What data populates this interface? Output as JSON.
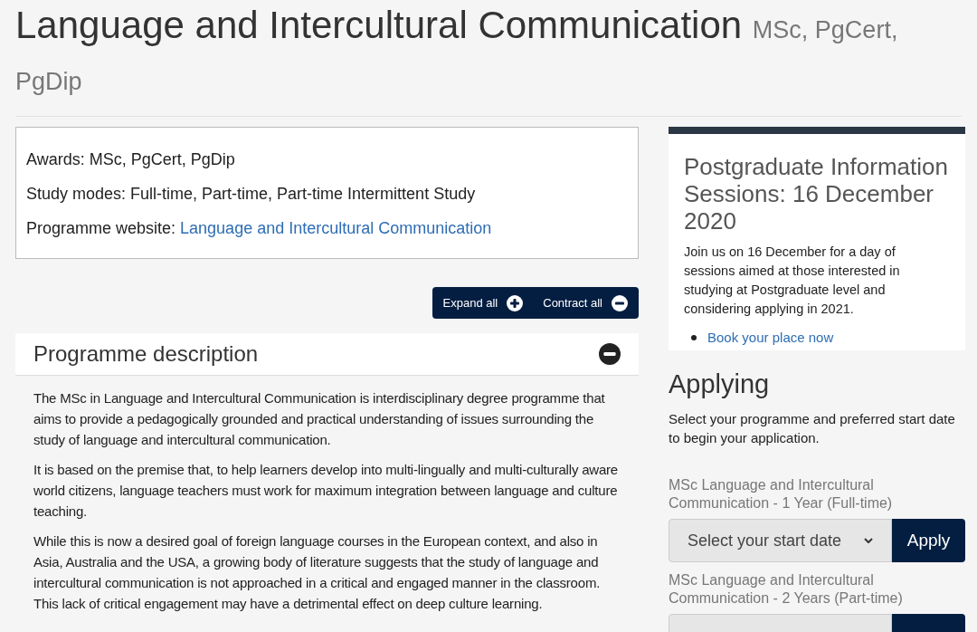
{
  "page_title": "Language and Intercultural Communication",
  "title_awards": "MSc, PgCert, PgDip",
  "summary": [
    {
      "label": "Awards:",
      "value": "MSc, PgCert, PgDip",
      "kind": "text"
    },
    {
      "label": "Study modes:",
      "value": "Full-time, Part-time, Part-time Intermittent Study",
      "kind": "text"
    },
    {
      "label": "Programme website:",
      "value": "Language and Intercultural Communication",
      "kind": "link"
    }
  ],
  "accordion_controls": [
    {
      "label": "Expand all",
      "kind": "expand"
    },
    {
      "label": "Contract all",
      "kind": "contract"
    }
  ],
  "sections": [
    {
      "title": "Programme description",
      "expanded": true,
      "paragraphs": [
        "The MSc in Language and Intercultural Communication is interdisciplinary degree programme that aims to provide a pedagogically grounded and practical understanding of issues surrounding the study of language and intercultural communication.",
        "It is based on the premise that, to help learners develop into multi-lingually and multi-culturally aware world citizens, language teachers must work for maximum integration between language and culture teaching.",
        "While this is now a desired goal of foreign language courses in the European context, and also in Asia, Australia and the USA, a growing body of literature suggests that the study of language and intercultural communication is not approached in a critical and engaged manner in the classroom. This lack of critical engagement may have a detrimental effect on deep culture learning."
      ]
    }
  ],
  "info_card": {
    "title": "Postgraduate Information Sessions: 16 December 2020",
    "text": "Join us on 16 December for a day of sessions aimed at those interested in studying at Postgraduate level and considering applying in 2021.",
    "links": [
      "Book your place now"
    ]
  },
  "applying": {
    "title": "Applying",
    "text": "Select your programme and preferred start date to begin your application.",
    "options": [
      {
        "programme": "MSc Language and Intercultural Communication - 1 Year (Full-time)",
        "select_value": "Select your start date",
        "button": "Apply"
      },
      {
        "programme": "MSc Language and Intercultural Communication - 2 Years (Part-time)"
      }
    ]
  }
}
